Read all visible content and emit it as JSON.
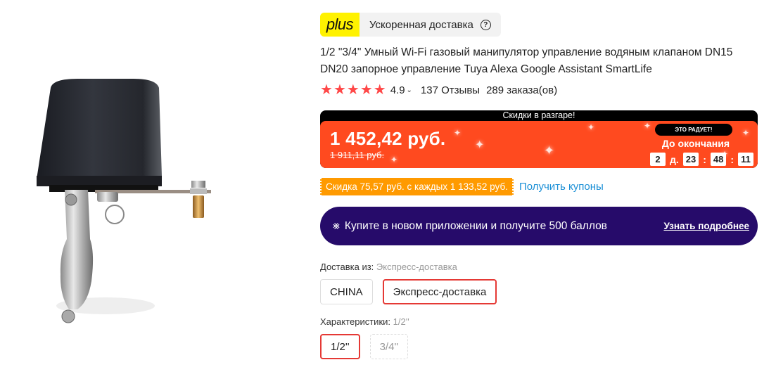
{
  "plus_badge": {
    "logo_text": "plus",
    "label": "Ускоренная доставка",
    "help_icon": "question-circle-icon"
  },
  "product": {
    "title": "1/2 \"3/4\" Умный Wi-Fi газовый манипулятор управление водяным клапаном DN15 DN20 запорное управление Tuya Alexa Google Assistant SmartLife",
    "image_alt": "Smart valve manipulator (black housing with chrome clamp)"
  },
  "rating": {
    "stars": 5,
    "value": "4.9",
    "reviews": "137 Отзывы",
    "orders": "289 заказа(ов)"
  },
  "promo": {
    "header": "Скидки в разгаре!",
    "price_now": "1 452,42 руб.",
    "price_old": "1 911,11 руб.",
    "badge": "ЭТО РАДУЕТ!",
    "until_label": "До окончания",
    "timer": {
      "days": "2",
      "days_suffix": "д.",
      "hours": "23",
      "minutes": "48",
      "seconds": "11",
      "separator": ":"
    },
    "colors": {
      "bg": "#ff4a1f",
      "header_bg": "#000000"
    }
  },
  "coupon": {
    "text": "Скидка 75,57 руб. с каждых 1 133,52 руб.",
    "link": "Получить купоны"
  },
  "app_banner": {
    "icon": "app-gift-icon",
    "text": "Купите в новом приложении и получите 500 баллов",
    "link": "Узнать подробнее"
  },
  "shipping": {
    "label": "Доставка из:",
    "selected_value": "Экспресс-доставка",
    "options": [
      {
        "label": "CHINA",
        "selected": false
      },
      {
        "label": "Экспресс-доставка",
        "selected": true
      }
    ]
  },
  "characteristics": {
    "label": "Характеристики:",
    "selected_value": "1/2''",
    "options": [
      {
        "label": "1/2''",
        "selected": true,
        "available": true
      },
      {
        "label": "3/4''",
        "selected": false,
        "available": false
      }
    ]
  }
}
